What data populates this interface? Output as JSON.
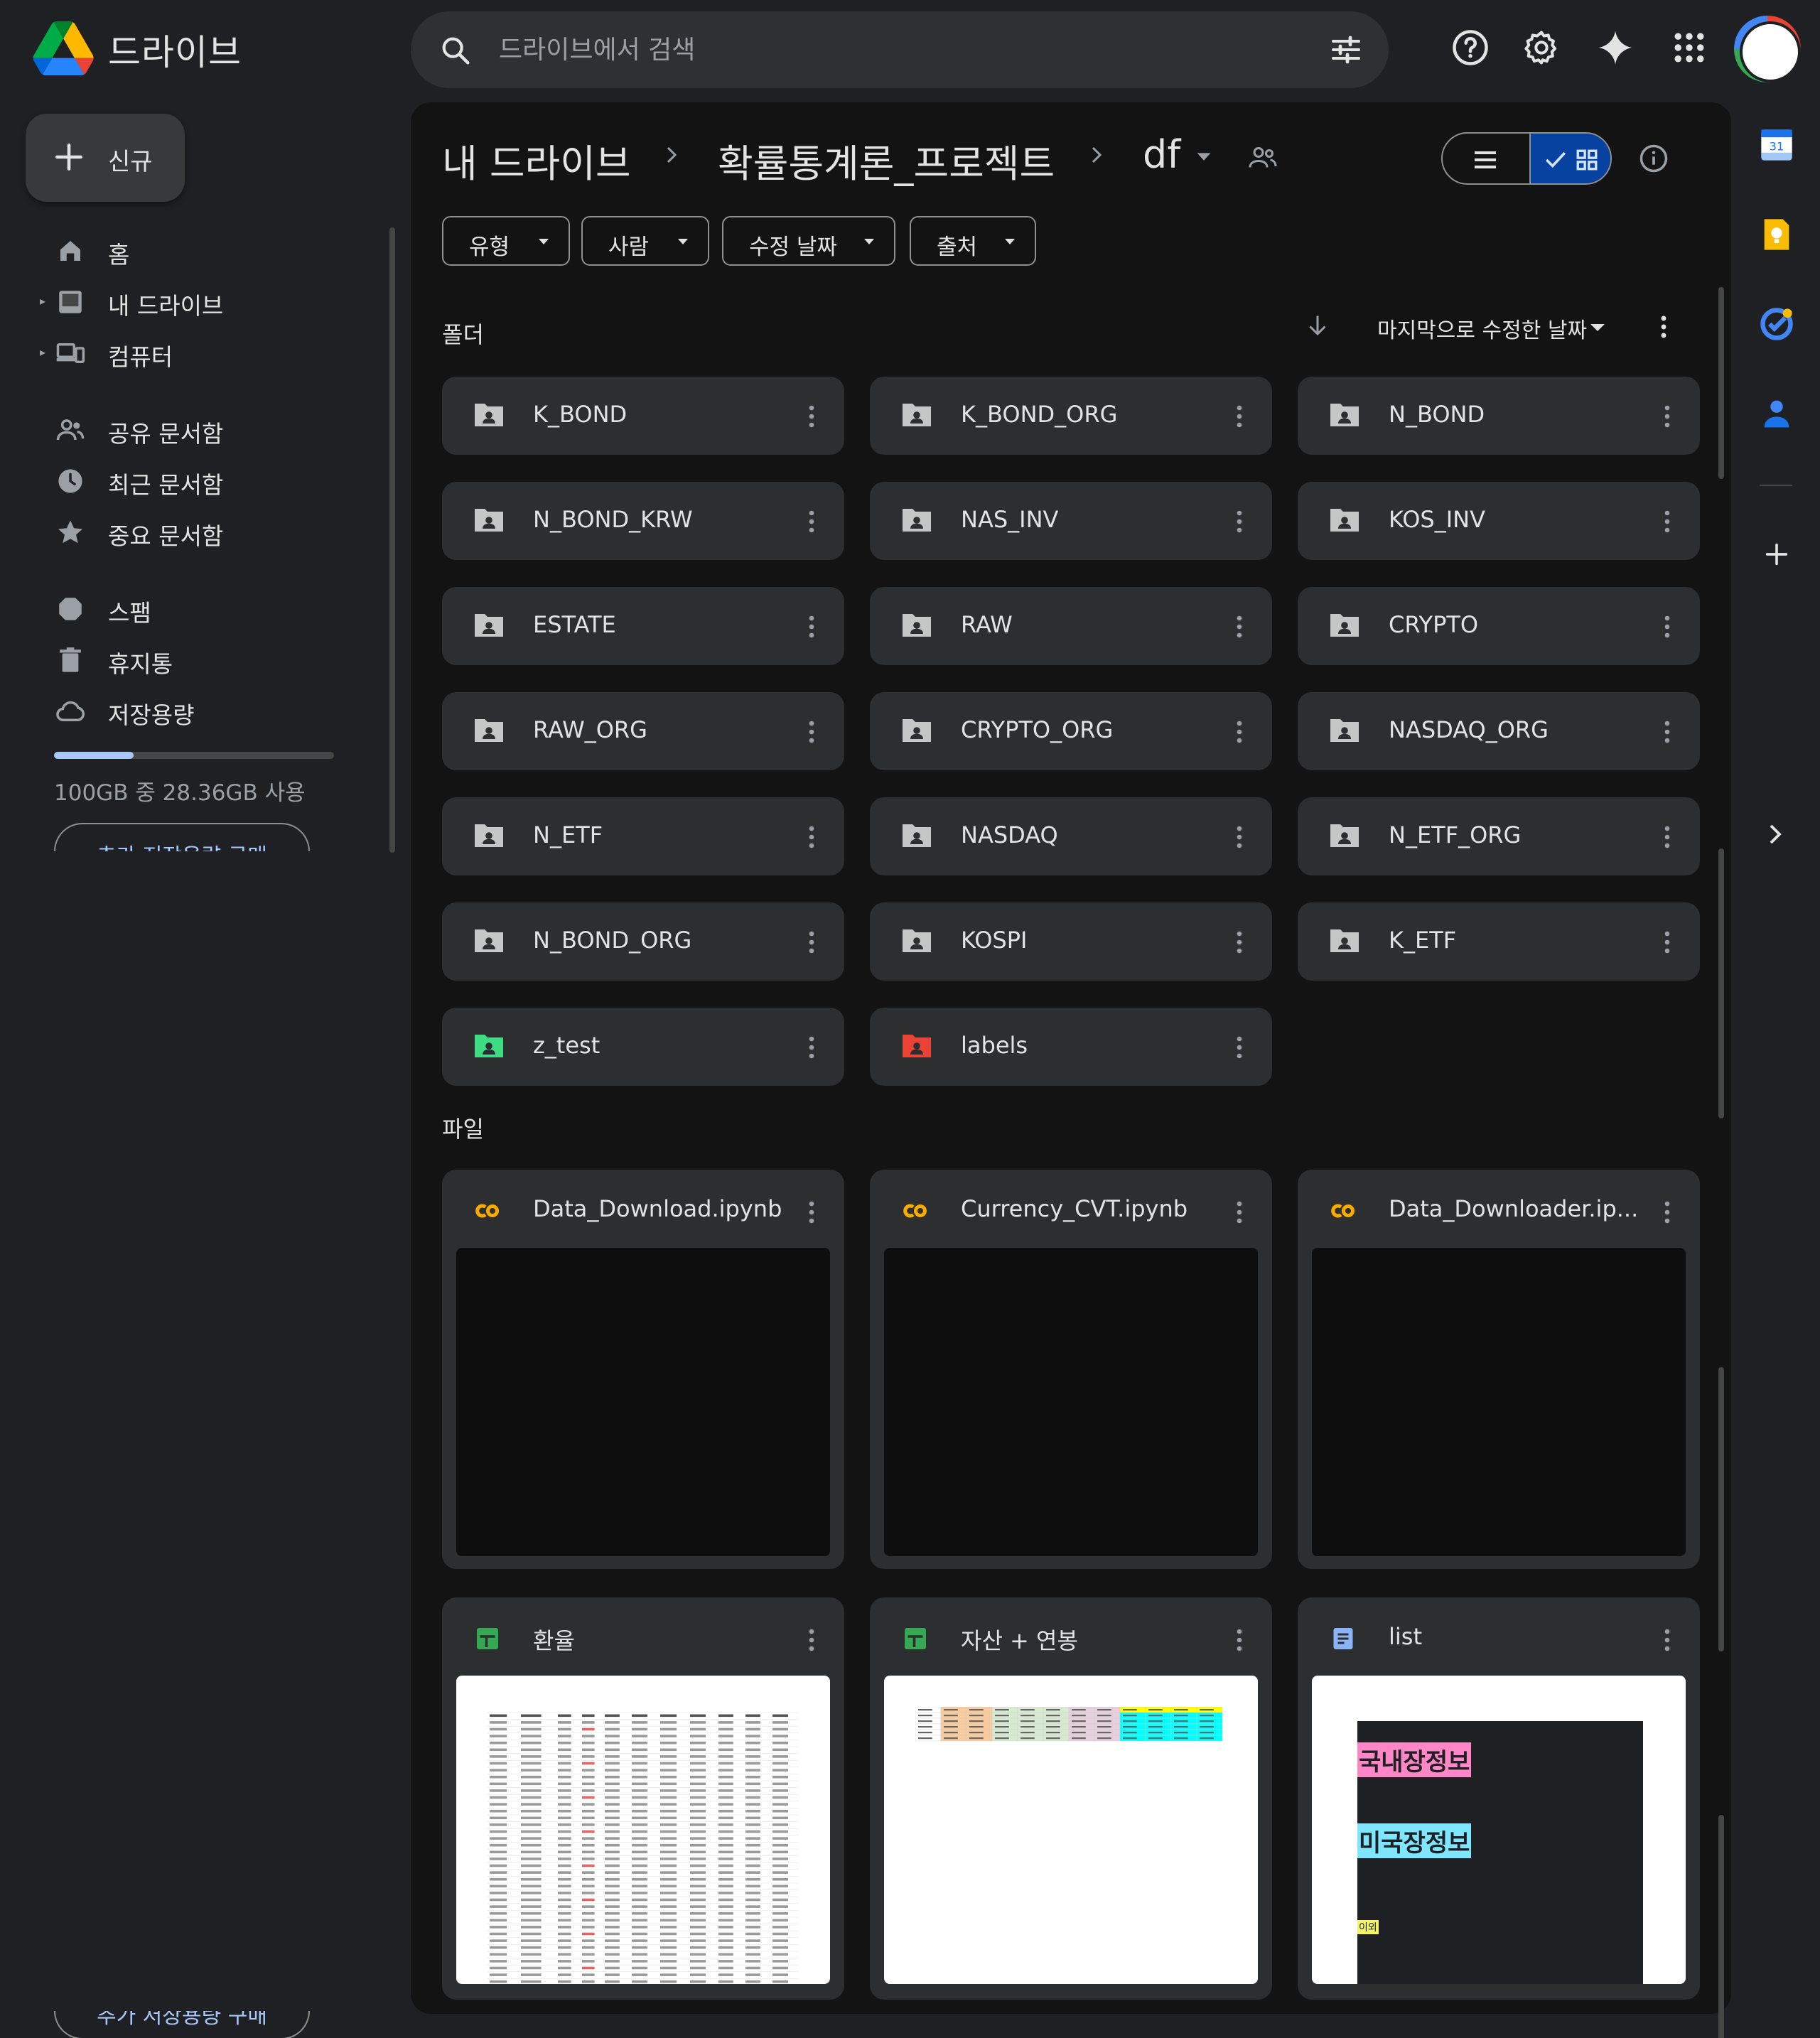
{
  "app": {
    "title": "드라이브",
    "search_placeholder": "드라이브에서 검색",
    "top_icons": [
      "help-icon",
      "settings-icon",
      "gemini-icon",
      "apps-grid-icon"
    ]
  },
  "sidebar": {
    "new_label": "신규",
    "items": [
      {
        "label": "홈",
        "icon": "home-icon"
      },
      {
        "label": "내 드라이브",
        "icon": "my-drive-icon"
      },
      {
        "label": "컴퓨터",
        "icon": "computers-icon"
      },
      {
        "label": "공유 문서함",
        "icon": "shared-icon"
      },
      {
        "label": "최근 문서함",
        "icon": "recent-icon"
      },
      {
        "label": "중요 문서함",
        "icon": "starred-icon"
      },
      {
        "label": "스팸",
        "icon": "spam-icon"
      },
      {
        "label": "휴지통",
        "icon": "trash-icon"
      },
      {
        "label": "저장용량",
        "icon": "storage-icon"
      }
    ],
    "storage_text": "100GB 중 28.36GB 사용",
    "storage_fraction": 0.2836,
    "buy_storage_label": "추가 저장용량 구매"
  },
  "breadcrumb": {
    "root": "내 드라이브",
    "parent": "확률통계론_프로젝트",
    "current": "df"
  },
  "filters": [
    "유형",
    "사람",
    "수정 날짜",
    "출처"
  ],
  "folders_section": {
    "title": "폴더",
    "sort_label": "마지막으로 수정한 날짜",
    "folders": [
      {
        "name": "K_BOND",
        "color": "#c4c7c5"
      },
      {
        "name": "K_BOND_ORG",
        "color": "#c4c7c5"
      },
      {
        "name": "N_BOND",
        "color": "#c4c7c5"
      },
      {
        "name": "N_BOND_KRW",
        "color": "#c4c7c5"
      },
      {
        "name": "NAS_INV",
        "color": "#c4c7c5"
      },
      {
        "name": "KOS_INV",
        "color": "#c4c7c5"
      },
      {
        "name": "ESTATE",
        "color": "#c4c7c5"
      },
      {
        "name": "RAW",
        "color": "#c4c7c5"
      },
      {
        "name": "CRYPTO",
        "color": "#c4c7c5"
      },
      {
        "name": "RAW_ORG",
        "color": "#c4c7c5"
      },
      {
        "name": "CRYPTO_ORG",
        "color": "#c4c7c5"
      },
      {
        "name": "NASDAQ_ORG",
        "color": "#c4c7c5"
      },
      {
        "name": "N_ETF",
        "color": "#c4c7c5"
      },
      {
        "name": "NASDAQ",
        "color": "#c4c7c5"
      },
      {
        "name": "N_ETF_ORG",
        "color": "#c4c7c5"
      },
      {
        "name": "N_BOND_ORG",
        "color": "#c4c7c5"
      },
      {
        "name": "KOSPI",
        "color": "#c4c7c5"
      },
      {
        "name": "K_ETF",
        "color": "#c4c7c5"
      },
      {
        "name": "z_test",
        "color": "#3ddc84"
      },
      {
        "name": "labels",
        "color": "#ea4335"
      }
    ]
  },
  "files_section": {
    "title": "파일",
    "files": [
      {
        "name": "Data_Download.ipynb",
        "type": "colab",
        "icon": "colab-icon"
      },
      {
        "name": "Currency_CVT.ipynb",
        "type": "colab",
        "icon": "colab-icon"
      },
      {
        "name": "Data_Downloader.ip...",
        "type": "colab",
        "icon": "colab-icon"
      },
      {
        "name": "환율",
        "type": "sheet",
        "icon": "sheets-icon"
      },
      {
        "name": "자산 + 연봉",
        "type": "sheet",
        "icon": "sheets-icon"
      },
      {
        "name": "list",
        "type": "doc",
        "icon": "docs-icon"
      }
    ],
    "list_preview": {
      "line1": "국내장정보",
      "line2": "미국장정보",
      "line3": "이외"
    }
  },
  "right_panel": {
    "apps": [
      "calendar-icon",
      "keep-icon",
      "tasks-icon",
      "contacts-icon"
    ],
    "calendar_day": "31"
  },
  "colors": {
    "accent": "#a8c7fa",
    "selected_toggle": "#0842a0",
    "folder_default": "#c4c7c5",
    "folder_green": "#3ddc84",
    "folder_red": "#ea4335",
    "colab_orange": "#f9ab00",
    "sheets_green": "#34a853",
    "docs_blue": "#8ab4f8"
  }
}
